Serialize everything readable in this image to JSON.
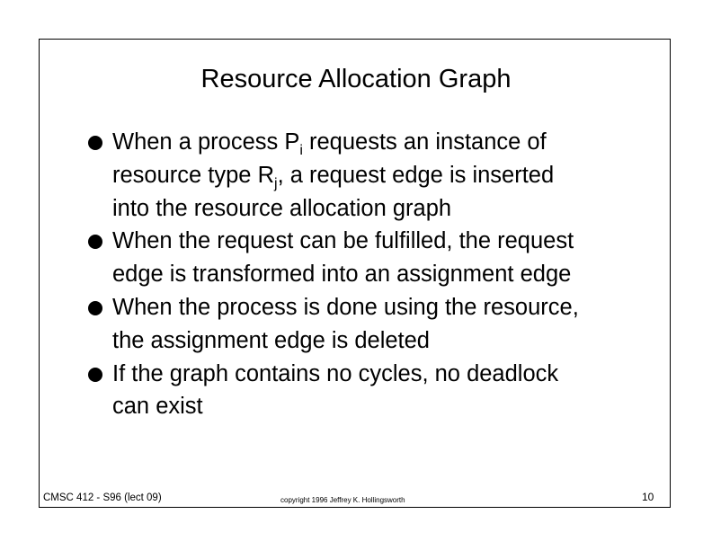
{
  "slide": {
    "title": "Resource Allocation Graph",
    "bullets": [
      {
        "line1_prefix": "When a process P",
        "line1_sub": "i",
        "line1_suffix": " requests an instance of",
        "line2_prefix": "resource type R",
        "line2_sub": "j",
        "line2_suffix": ", a request edge is inserted",
        "line3": "into the resource allocation graph"
      },
      {
        "line1": "When the request can be fulfilled, the request",
        "line2": "edge is transformed into an assignment edge"
      },
      {
        "line1": "When the process is done using the resource,",
        "line2": "the assignment edge is deleted"
      },
      {
        "line1": "If the graph contains no cycles, no deadlock",
        "line2": "can exist"
      }
    ]
  },
  "footer": {
    "course": "CMSC 412 - S96 (lect 09)",
    "copyright": "copyright 1996 Jeffrey K. Hollingsworth",
    "page_number": "10"
  }
}
